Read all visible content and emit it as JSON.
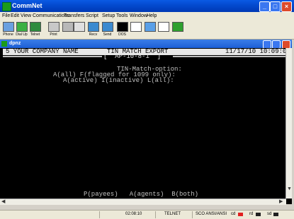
{
  "window": {
    "title": "CommNet",
    "minimize": "_",
    "maximize": "□",
    "close": "×"
  },
  "menu": [
    "File",
    "Edit",
    "View",
    "Communications",
    "Transfers",
    "Script",
    "Setup",
    "Tools",
    "Window",
    "Help"
  ],
  "toolbar": {
    "phone": "Phone",
    "dialup": "Dial Up",
    "telnet": "Telnet",
    "print": "Print",
    "recv": "Recv",
    "send": "Send",
    "dos": "DOS"
  },
  "session": {
    "title": "dpnz"
  },
  "terminal": {
    "company": "5 YOUR COMPANY NAME",
    "report": "TIN MATCH EXPORT",
    "screen_code": "[  AP-10-8-1  ]",
    "datetime": "11/17/10 10:09:02",
    "prompt": "TIN-Match-option:",
    "option_line1": "A(all) F(flagged for 1099 only):",
    "option_line2": "A(active) I(inactive) L(all):",
    "footer": "P(payees)   A(agents)  B(both)"
  },
  "status": {
    "time": "02:08:10",
    "protocol": "TELNET",
    "emulation": "SCO ANSI/ANSI",
    "cd": "cd",
    "rd": "rd",
    "sd": "sd"
  },
  "colors": {
    "titlebar": "#0246c9",
    "terminal_bg": "#000000",
    "terminal_fg": "#c0c0c0"
  }
}
